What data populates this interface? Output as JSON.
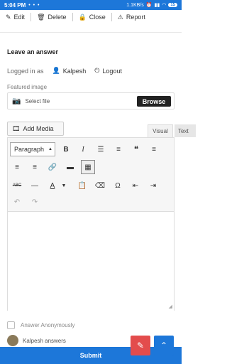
{
  "status": {
    "time": "5:04 PM",
    "dots": "• • •",
    "speed": "1.1KB/s",
    "battery": "15"
  },
  "actions": [
    {
      "label": "Edit",
      "icon": "pencil-icon"
    },
    {
      "label": "Delete",
      "icon": "trash-icon"
    },
    {
      "label": "Close",
      "icon": "lock-icon"
    },
    {
      "label": "Report",
      "icon": "warning-icon"
    }
  ],
  "form": {
    "title": "Leave an answer",
    "logged_in_as": "Logged in as",
    "user": "Kalpesh",
    "logout": "Logout",
    "featured_image_label": "Featured image",
    "select_file": "Select file",
    "browse": "Browse",
    "add_media": "Add Media",
    "tab_visual": "Visual",
    "tab_text": "Text",
    "format_select": "Paragraph",
    "answer_anonymously": "Answer Anonymously",
    "kalpesh_answers": "Kalpesh answers",
    "submit": "Submit"
  },
  "toolbar": {
    "bold": "B",
    "italic": "I",
    "blockquote": "❝",
    "abc": "ABC",
    "text_color": "A",
    "omega": "Ω"
  },
  "colors": {
    "accent": "#1d77d9",
    "danger": "#e34c4c"
  }
}
